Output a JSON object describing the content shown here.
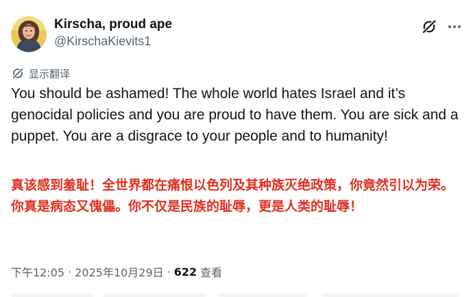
{
  "user": {
    "display_name": "Kirscha, proud ape",
    "handle": "@KirschaKievits1",
    "avatar_icon": "user-avatar-photo"
  },
  "actions": {
    "grok_icon": "grok-icon",
    "more_icon": "more-horizontal-icon"
  },
  "translate": {
    "icon": "translate-icon",
    "label": "显示翻译"
  },
  "tweet": {
    "text": "You should be ashamed! The whole world hates Israel and it’s genocidal policies and you are proud to have them. You are sick and a puppet. You are a disgrace to your people and to humanity!",
    "translation": "真该感到羞耻！全世界都在痛恨以色列及其种族灭绝政策，你竟然引以为荣。你真是病态又傀儡。你不仅是民族的耻辱，更是人类的耻辱！"
  },
  "meta": {
    "time": "下午12:05",
    "separator": "·",
    "date": "2025年10月29日",
    "views_count": "622",
    "views_label": "查看"
  },
  "colors": {
    "text_primary": "#0f1419",
    "text_secondary": "#536471",
    "translation_red": "#e0301e"
  }
}
